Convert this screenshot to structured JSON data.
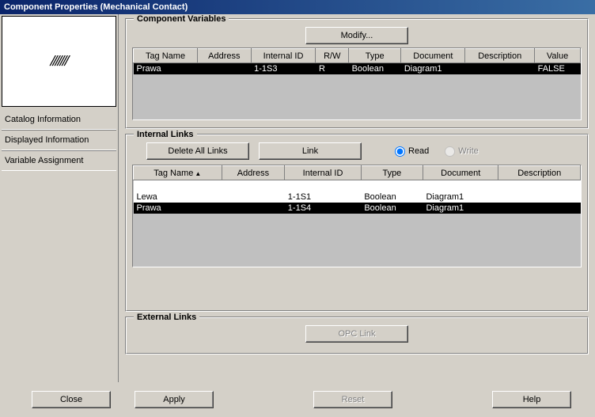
{
  "title": "Component Properties (Mechanical Contact)",
  "nav": {
    "items": [
      "Catalog Information",
      "Displayed Information",
      "Variable Assignment"
    ]
  },
  "cv": {
    "legend": "Component Variables",
    "modify": "Modify...",
    "headers": [
      "Tag Name",
      "Address",
      "Internal ID",
      "R/W",
      "Type",
      "Document",
      "Description",
      "Value"
    ],
    "rows": [
      {
        "cells": [
          "Prawa",
          "",
          "1-1S3",
          "R",
          "Boolean",
          "Diagram1",
          "",
          "FALSE"
        ],
        "selected": true
      }
    ]
  },
  "il": {
    "legend": "Internal Links",
    "deleteAll": "Delete All Links",
    "link": "Link",
    "read": "Read",
    "write": "Write",
    "headers": [
      "Tag Name",
      "Address",
      "Internal ID",
      "Type",
      "Document",
      "Description"
    ],
    "rows": [
      {
        "cells": [
          "",
          "",
          "",
          "",
          "",
          ""
        ],
        "cls": "white-row"
      },
      {
        "cells": [
          "Lewa",
          "",
          "1-1S1",
          "Boolean",
          "Diagram1",
          ""
        ],
        "cls": "white-row"
      },
      {
        "cells": [
          "Prawa",
          "",
          "1-1S4",
          "Boolean",
          "Diagram1",
          ""
        ],
        "cls": "sel-row"
      }
    ]
  },
  "el": {
    "legend": "External Links",
    "opc": "OPC Link"
  },
  "buttons": {
    "close": "Close",
    "apply": "Apply",
    "reset": "Reset",
    "help": "Help"
  }
}
